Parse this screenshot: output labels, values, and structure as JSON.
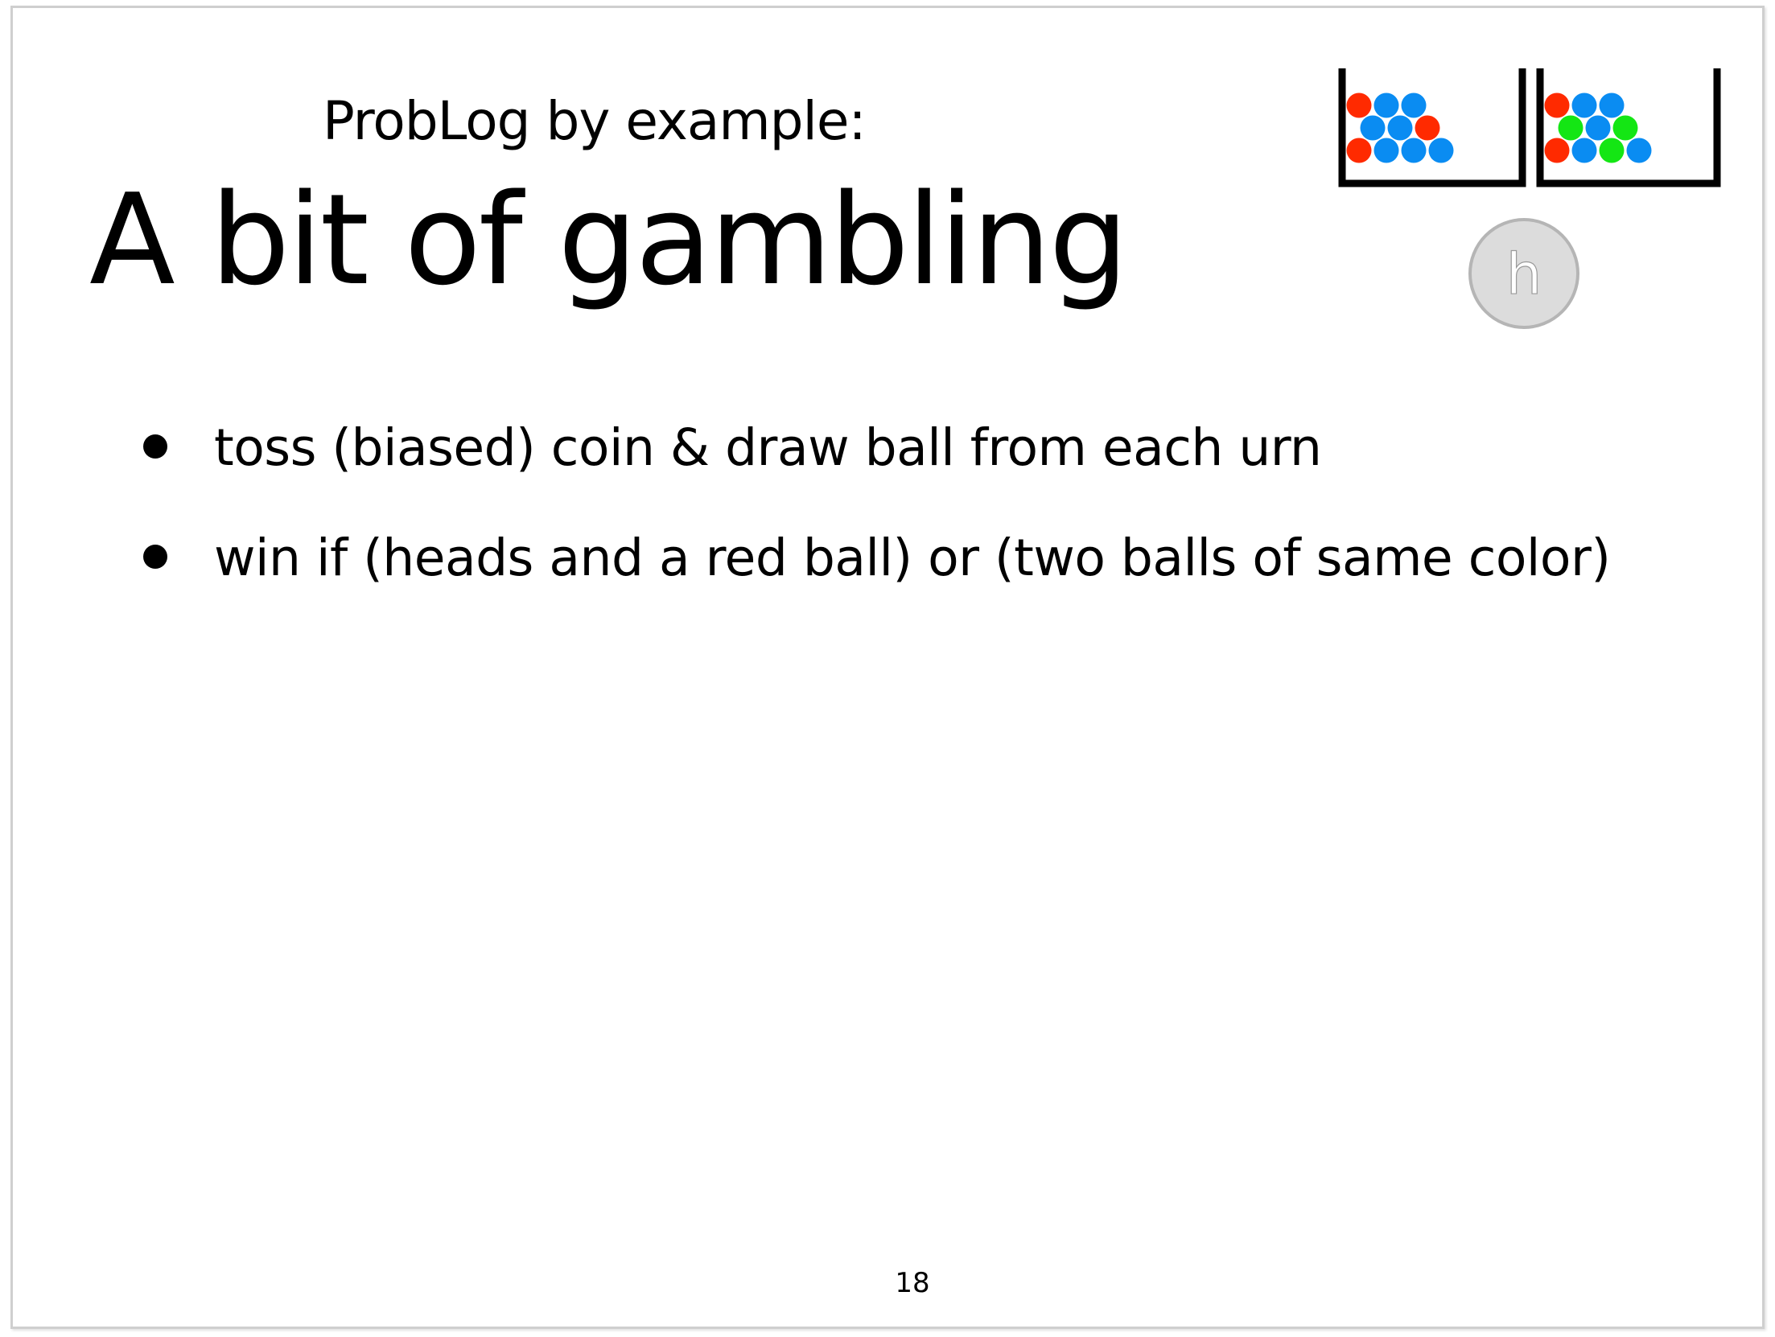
{
  "slide": {
    "subtitle": "ProbLog by example:",
    "title": "A bit of gambling",
    "bullets": [
      {
        "text": "toss (biased) coin & draw ball from each urn"
      },
      {
        "text": "win if (heads and a red ball) or (two balls of same color)"
      }
    ],
    "page_number": "18"
  },
  "illustration": {
    "urn1_balls": [
      "red",
      "blue",
      "blue",
      "blue",
      "blue",
      "red",
      "red",
      "blue",
      "blue",
      "blue"
    ],
    "urn2_balls": [
      "red",
      "blue",
      "blue",
      "green",
      "blue",
      "green",
      "red",
      "blue",
      "green",
      "blue"
    ],
    "coin_label": "h"
  },
  "colors": {
    "red": "#ff2a00",
    "blue": "#0a8cf2",
    "green": "#14e614",
    "coin_fill": "#dcdcdc",
    "coin_stroke": "#b5b5b5"
  }
}
